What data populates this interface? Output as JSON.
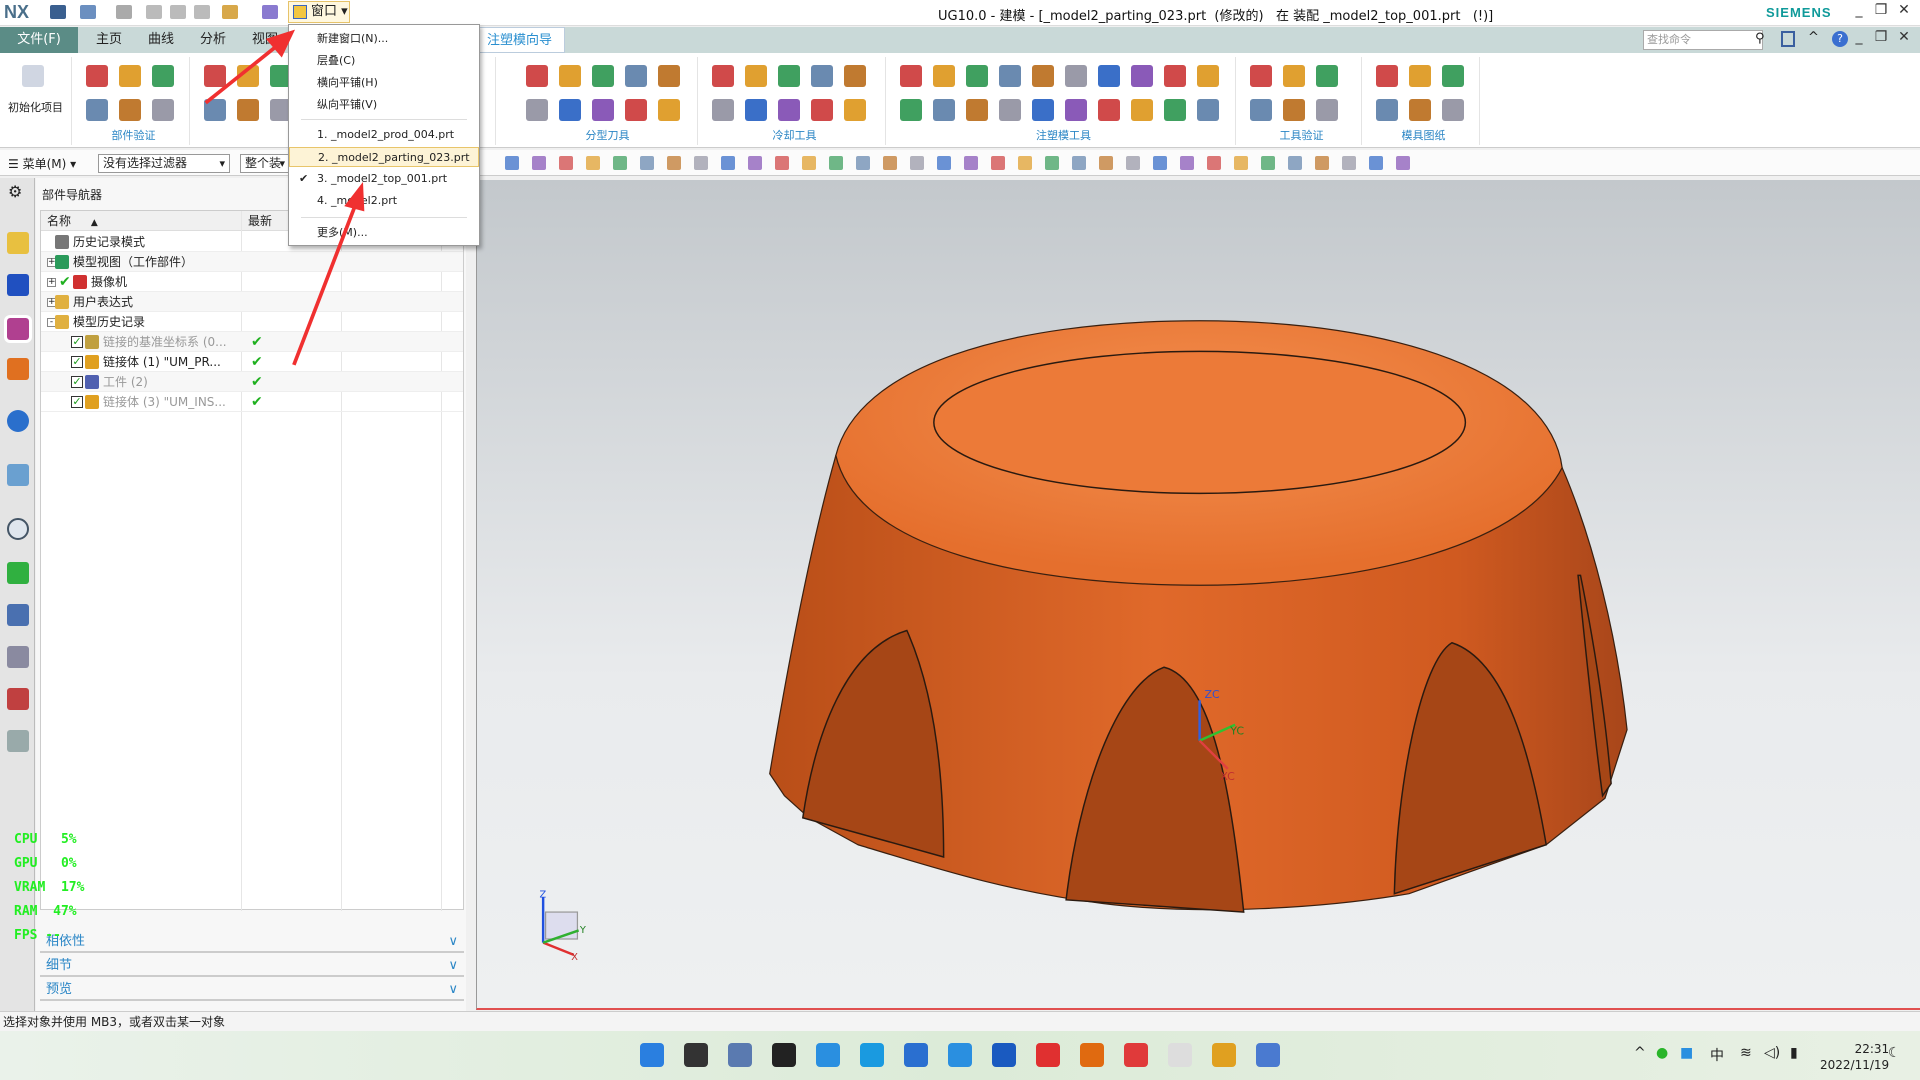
{
  "app": {
    "logo": "NX",
    "title": "UG10.0 - 建模 - [_model2_parting_023.prt  (修改的)   在 装配 _model2_top_001.prt   (!)]",
    "brand": "SIEMENS"
  },
  "window_menu": {
    "label": "窗口",
    "items": [
      "新建窗口(N)...",
      "层叠(C)",
      "横向平铺(H)",
      "纵向平铺(V)"
    ],
    "files": [
      {
        "label": "1. _model2_prod_004.prt",
        "checked": false,
        "highlighted": false
      },
      {
        "label": "2. _model2_parting_023.prt",
        "checked": false,
        "highlighted": true
      },
      {
        "label": "3. _model2_top_001.prt",
        "checked": true,
        "highlighted": false
      },
      {
        "label": "4. _model2.prt",
        "checked": false,
        "highlighted": false
      }
    ],
    "more": "更多(M)..."
  },
  "tabs": [
    {
      "label": "文件(F)"
    },
    {
      "label": "主页"
    },
    {
      "label": "曲线"
    },
    {
      "label": "分析"
    },
    {
      "label": "视图"
    },
    {
      "label": "注塑模向导",
      "active": true
    }
  ],
  "search": {
    "placeholder": "查找命令"
  },
  "ribbon": {
    "init_label": "初始化项目",
    "groups": [
      "部件验证",
      "分型刀具",
      "冷却工具",
      "注塑模工具",
      "工具验证",
      "模具图纸"
    ]
  },
  "selection_bar": {
    "menu": "菜单(M)",
    "filter": "没有选择过滤器",
    "scope": "整个装配"
  },
  "navigator": {
    "title": "部件导航器",
    "columns": [
      "名称",
      "最新"
    ],
    "rows": [
      {
        "label": "历史记录模式",
        "level": 0,
        "expander": "",
        "dim": false,
        "latest": false
      },
      {
        "label": "模型视图（工作部件）",
        "level": 0,
        "expander": "+",
        "dim": false,
        "latest": false
      },
      {
        "label": "摄像机",
        "level": 0,
        "expander": "+",
        "dim": false,
        "latest": false,
        "check": true
      },
      {
        "label": "用户表达式",
        "level": 0,
        "expander": "+",
        "dim": false,
        "latest": false
      },
      {
        "label": "模型历史记录",
        "level": 0,
        "expander": "-",
        "dim": false,
        "latest": false
      },
      {
        "label": "链接的基准坐标系 (0...",
        "level": 1,
        "expander": "",
        "dim": true,
        "latest": true
      },
      {
        "label": "链接体 (1) \"UM_PR...",
        "level": 1,
        "expander": "",
        "dim": false,
        "latest": true
      },
      {
        "label": "工件 (2)",
        "level": 1,
        "expander": "",
        "dim": true,
        "latest": true
      },
      {
        "label": "链接体 (3) \"UM_INS...",
        "level": 1,
        "expander": "",
        "dim": true,
        "latest": true
      }
    ],
    "panels": [
      "相依性",
      "细节",
      "预览"
    ]
  },
  "stats": {
    "cpu": "CPU   5%",
    "gpu": "GPU   0%",
    "vram": "VRAM  17%",
    "ram": "RAM  47%",
    "fps": "FPS --"
  },
  "viewport": {
    "axis_labels": {
      "zc": "ZC",
      "yc": "YC",
      "xc": "XC",
      "z": "Z",
      "y": "Y",
      "x": "X"
    },
    "model_color": "#e3692a"
  },
  "status": {
    "message": "选择对象并使用 MB3，或者双击某一对象"
  },
  "taskbar": {
    "time": "22:31",
    "date": "2022/11/19",
    "ime": "中"
  }
}
